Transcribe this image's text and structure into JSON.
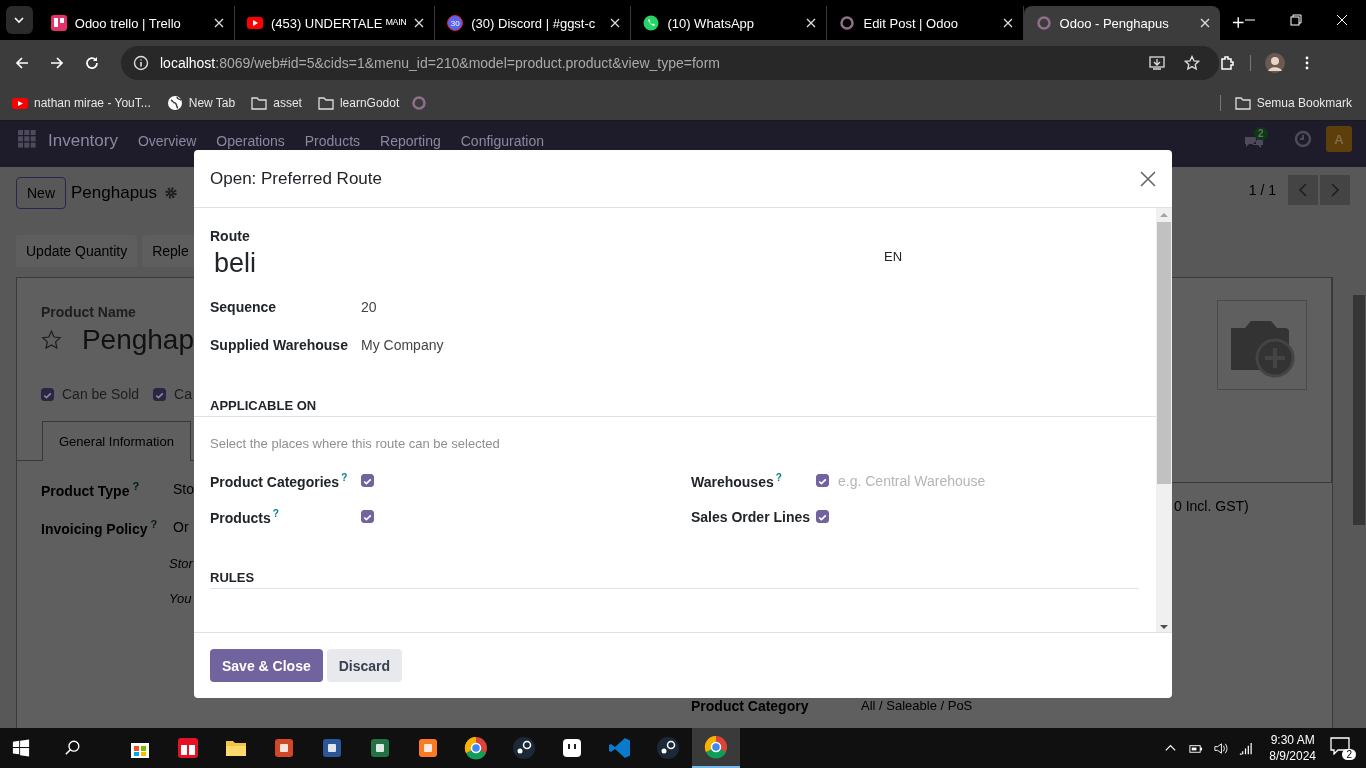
{
  "browser": {
    "tabs": [
      {
        "title": "Odoo trello | Trello",
        "selected": false
      },
      {
        "title": "(453) UNDERTALE ᴹᴬᴵᴺ",
        "selected": false
      },
      {
        "title": "(30) Discord | #ggst-c",
        "badge": "30",
        "selected": false
      },
      {
        "title": "(10) WhatsApp",
        "selected": false
      },
      {
        "title": "Edit Post | Odoo",
        "selected": false
      },
      {
        "title": "Odoo - Penghapus",
        "selected": true
      }
    ],
    "address": {
      "host": "localhost",
      "path": ":8069/web#id=5&cids=1&menu_id=210&model=product.product&view_type=form"
    },
    "bookmarks": [
      "nathan mirae - YouT...",
      "New Tab",
      "asset",
      "learnGodot"
    ],
    "bookmark_folder": "Semua Bookmark"
  },
  "navbar": {
    "app": "Inventory",
    "menu": [
      "Overview",
      "Operations",
      "Products",
      "Reporting",
      "Configuration"
    ],
    "chat_badge": "2",
    "avatar": "A"
  },
  "control": {
    "new": "New",
    "record": "Penghapus",
    "pager": "1 / 1"
  },
  "actions": [
    "Update Quantity",
    "Reple"
  ],
  "sheet": {
    "name_label": "Product Name",
    "name": "Penghap",
    "options": [
      {
        "label": "Can be Sold",
        "checked": true
      },
      {
        "label": "Ca",
        "checked": true
      }
    ],
    "tab": "General Information",
    "fields": [
      {
        "label": "Product Type",
        "help": "?",
        "value": "Sto"
      },
      {
        "label": "Invoicing Policy",
        "help": "?",
        "value": "Or"
      }
    ],
    "notes": [
      "Stor",
      "You"
    ],
    "price": "0 Incl. GST)",
    "category_label": "Product Category",
    "category": "All / Saleable / PoS"
  },
  "dialog": {
    "title": "Open: Preferred Route",
    "route": {
      "label": "Route",
      "value": "beli",
      "lang": "EN"
    },
    "fields": [
      {
        "label": "Sequence",
        "value": "20"
      },
      {
        "label": "Supplied Warehouse",
        "value": "My Company"
      }
    ],
    "applicable_heading": "APPLICABLE ON",
    "applicable_help": "Select the places where this route can be selected",
    "applicable": [
      {
        "label": "Product Categories",
        "help": "?",
        "checked": true
      },
      {
        "label": "Warehouses",
        "help": "?",
        "checked": true,
        "placeholder": "e.g. Central Warehouse"
      },
      {
        "label": "Products",
        "help": "?",
        "checked": true
      },
      {
        "label": "Sales Order Lines",
        "checked": true
      }
    ],
    "rules_heading": "RULES",
    "buttons": [
      {
        "label": "Save & Close",
        "kind": "primary"
      },
      {
        "label": "Discard",
        "kind": "secondary"
      }
    ]
  },
  "taskbar": {
    "apps": [
      {
        "kind": "store"
      },
      {
        "kind": "gift"
      },
      {
        "kind": "folder"
      },
      {
        "kind": "powerpoint"
      },
      {
        "kind": "word"
      },
      {
        "kind": "excel"
      },
      {
        "kind": "xampp"
      },
      {
        "kind": "chrome"
      },
      {
        "kind": "steam"
      },
      {
        "kind": "face"
      },
      {
        "kind": "vscode"
      },
      {
        "kind": "steam"
      },
      {
        "kind": "chrome",
        "selected": true
      }
    ],
    "time": "9:30 AM",
    "date": "8/9/2024",
    "notifications": "2"
  }
}
